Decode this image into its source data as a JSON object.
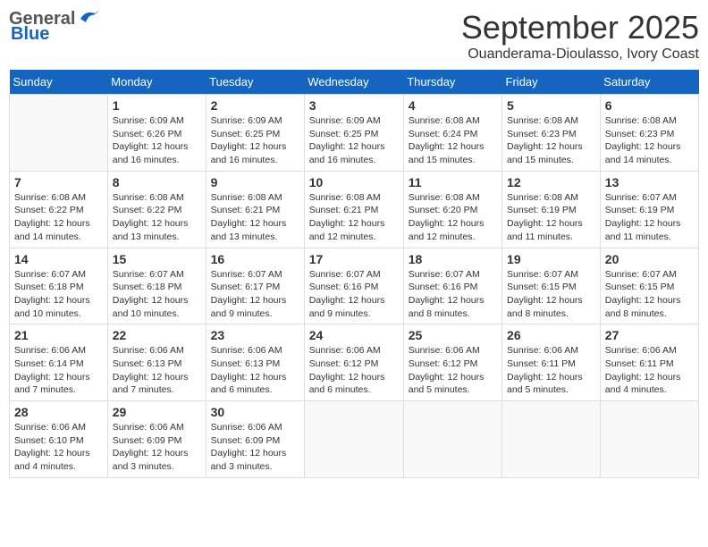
{
  "header": {
    "logo_general": "General",
    "logo_blue": "Blue",
    "month_title": "September 2025",
    "location": "Ouanderama-Dioulasso, Ivory Coast"
  },
  "days_of_week": [
    "Sunday",
    "Monday",
    "Tuesday",
    "Wednesday",
    "Thursday",
    "Friday",
    "Saturday"
  ],
  "weeks": [
    [
      {
        "day": "",
        "info": ""
      },
      {
        "day": "1",
        "info": "Sunrise: 6:09 AM\nSunset: 6:26 PM\nDaylight: 12 hours\nand 16 minutes."
      },
      {
        "day": "2",
        "info": "Sunrise: 6:09 AM\nSunset: 6:25 PM\nDaylight: 12 hours\nand 16 minutes."
      },
      {
        "day": "3",
        "info": "Sunrise: 6:09 AM\nSunset: 6:25 PM\nDaylight: 12 hours\nand 16 minutes."
      },
      {
        "day": "4",
        "info": "Sunrise: 6:08 AM\nSunset: 6:24 PM\nDaylight: 12 hours\nand 15 minutes."
      },
      {
        "day": "5",
        "info": "Sunrise: 6:08 AM\nSunset: 6:23 PM\nDaylight: 12 hours\nand 15 minutes."
      },
      {
        "day": "6",
        "info": "Sunrise: 6:08 AM\nSunset: 6:23 PM\nDaylight: 12 hours\nand 14 minutes."
      }
    ],
    [
      {
        "day": "7",
        "info": "Sunrise: 6:08 AM\nSunset: 6:22 PM\nDaylight: 12 hours\nand 14 minutes."
      },
      {
        "day": "8",
        "info": "Sunrise: 6:08 AM\nSunset: 6:22 PM\nDaylight: 12 hours\nand 13 minutes."
      },
      {
        "day": "9",
        "info": "Sunrise: 6:08 AM\nSunset: 6:21 PM\nDaylight: 12 hours\nand 13 minutes."
      },
      {
        "day": "10",
        "info": "Sunrise: 6:08 AM\nSunset: 6:21 PM\nDaylight: 12 hours\nand 12 minutes."
      },
      {
        "day": "11",
        "info": "Sunrise: 6:08 AM\nSunset: 6:20 PM\nDaylight: 12 hours\nand 12 minutes."
      },
      {
        "day": "12",
        "info": "Sunrise: 6:08 AM\nSunset: 6:19 PM\nDaylight: 12 hours\nand 11 minutes."
      },
      {
        "day": "13",
        "info": "Sunrise: 6:07 AM\nSunset: 6:19 PM\nDaylight: 12 hours\nand 11 minutes."
      }
    ],
    [
      {
        "day": "14",
        "info": "Sunrise: 6:07 AM\nSunset: 6:18 PM\nDaylight: 12 hours\nand 10 minutes."
      },
      {
        "day": "15",
        "info": "Sunrise: 6:07 AM\nSunset: 6:18 PM\nDaylight: 12 hours\nand 10 minutes."
      },
      {
        "day": "16",
        "info": "Sunrise: 6:07 AM\nSunset: 6:17 PM\nDaylight: 12 hours\nand 9 minutes."
      },
      {
        "day": "17",
        "info": "Sunrise: 6:07 AM\nSunset: 6:16 PM\nDaylight: 12 hours\nand 9 minutes."
      },
      {
        "day": "18",
        "info": "Sunrise: 6:07 AM\nSunset: 6:16 PM\nDaylight: 12 hours\nand 8 minutes."
      },
      {
        "day": "19",
        "info": "Sunrise: 6:07 AM\nSunset: 6:15 PM\nDaylight: 12 hours\nand 8 minutes."
      },
      {
        "day": "20",
        "info": "Sunrise: 6:07 AM\nSunset: 6:15 PM\nDaylight: 12 hours\nand 8 minutes."
      }
    ],
    [
      {
        "day": "21",
        "info": "Sunrise: 6:06 AM\nSunset: 6:14 PM\nDaylight: 12 hours\nand 7 minutes."
      },
      {
        "day": "22",
        "info": "Sunrise: 6:06 AM\nSunset: 6:13 PM\nDaylight: 12 hours\nand 7 minutes."
      },
      {
        "day": "23",
        "info": "Sunrise: 6:06 AM\nSunset: 6:13 PM\nDaylight: 12 hours\nand 6 minutes."
      },
      {
        "day": "24",
        "info": "Sunrise: 6:06 AM\nSunset: 6:12 PM\nDaylight: 12 hours\nand 6 minutes."
      },
      {
        "day": "25",
        "info": "Sunrise: 6:06 AM\nSunset: 6:12 PM\nDaylight: 12 hours\nand 5 minutes."
      },
      {
        "day": "26",
        "info": "Sunrise: 6:06 AM\nSunset: 6:11 PM\nDaylight: 12 hours\nand 5 minutes."
      },
      {
        "day": "27",
        "info": "Sunrise: 6:06 AM\nSunset: 6:11 PM\nDaylight: 12 hours\nand 4 minutes."
      }
    ],
    [
      {
        "day": "28",
        "info": "Sunrise: 6:06 AM\nSunset: 6:10 PM\nDaylight: 12 hours\nand 4 minutes."
      },
      {
        "day": "29",
        "info": "Sunrise: 6:06 AM\nSunset: 6:09 PM\nDaylight: 12 hours\nand 3 minutes."
      },
      {
        "day": "30",
        "info": "Sunrise: 6:06 AM\nSunset: 6:09 PM\nDaylight: 12 hours\nand 3 minutes."
      },
      {
        "day": "",
        "info": ""
      },
      {
        "day": "",
        "info": ""
      },
      {
        "day": "",
        "info": ""
      },
      {
        "day": "",
        "info": ""
      }
    ]
  ]
}
